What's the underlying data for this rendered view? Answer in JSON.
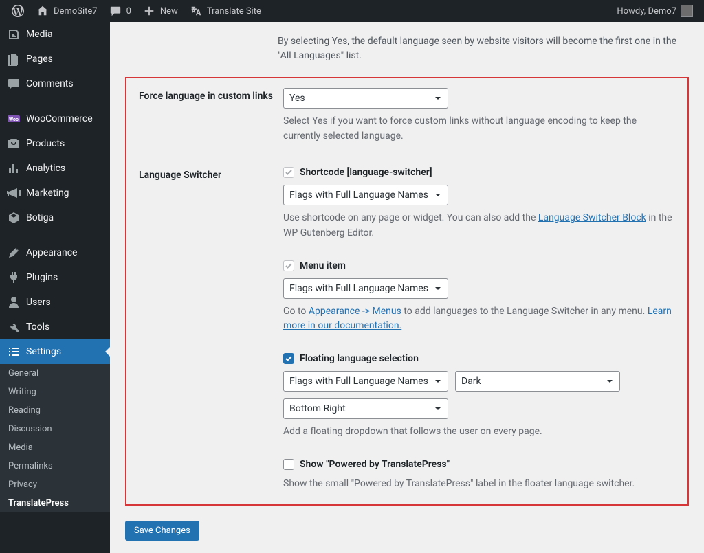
{
  "adminbar": {
    "site_name": "DemoSite7",
    "comments_count": "0",
    "new_label": "New",
    "translate_label": "Translate Site",
    "howdy": "Howdy, Demo7"
  },
  "sidebar": {
    "items": [
      {
        "label": "Media"
      },
      {
        "label": "Pages"
      },
      {
        "label": "Comments"
      },
      {
        "label": "WooCommerce"
      },
      {
        "label": "Products"
      },
      {
        "label": "Analytics"
      },
      {
        "label": "Marketing"
      },
      {
        "label": "Botiga"
      },
      {
        "label": "Appearance"
      },
      {
        "label": "Plugins"
      },
      {
        "label": "Users"
      },
      {
        "label": "Tools"
      },
      {
        "label": "Settings"
      }
    ],
    "submenu": [
      {
        "label": "General"
      },
      {
        "label": "Writing"
      },
      {
        "label": "Reading"
      },
      {
        "label": "Discussion"
      },
      {
        "label": "Media"
      },
      {
        "label": "Permalinks"
      },
      {
        "label": "Privacy"
      },
      {
        "label": "TranslatePress"
      }
    ]
  },
  "intro": "By selecting Yes, the default language seen by website visitors will become the first one in the \"All Languages\" list.",
  "force_links": {
    "label": "Force language in custom links",
    "value": "Yes",
    "desc": "Select Yes if you want to force custom links without language encoding to keep the currently selected language."
  },
  "switcher": {
    "label": "Language Switcher",
    "shortcode": {
      "label": "Shortcode [language-switcher]",
      "value": "Flags with Full Language Names",
      "desc_pre": "Use shortcode on any page or widget. You can also add the ",
      "link": "Language Switcher Block",
      "desc_post": " in the WP Gutenberg Editor."
    },
    "menu": {
      "label": "Menu item",
      "value": "Flags with Full Language Names",
      "desc_pre": "Go to ",
      "link1": "Appearance -> Menus",
      "mid": " to add languages to the Language Switcher in any menu. ",
      "link2": "Learn more in our documentation."
    },
    "floating": {
      "label": "Floating language selection",
      "style": "Flags with Full Language Names",
      "theme": "Dark",
      "position": "Bottom Right",
      "desc": "Add a floating dropdown that follows the user on every page."
    },
    "powered": {
      "label": "Show \"Powered by TranslatePress\"",
      "desc": "Show the small \"Powered by TranslatePress\" label in the floater language switcher."
    }
  },
  "save_label": "Save Changes"
}
